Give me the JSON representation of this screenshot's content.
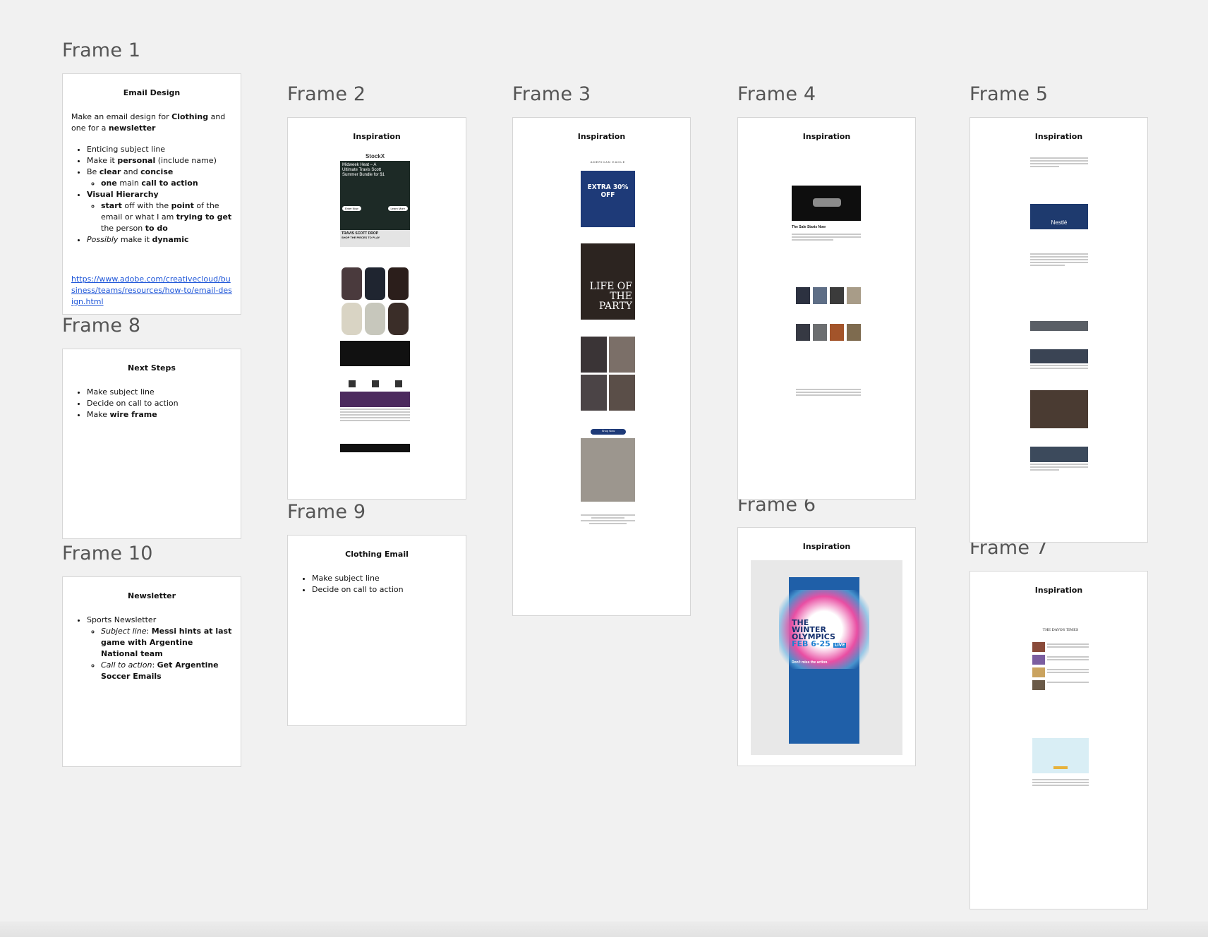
{
  "frames": {
    "f1": {
      "label": "Frame 1",
      "title": "Email Design",
      "intro_a": "Make an email design for ",
      "intro_b": "Clothing",
      "intro_c": " and one for a ",
      "intro_d": "newsletter",
      "b1": "Enticing subject line",
      "b2_a": "Make it ",
      "b2_b": "personal",
      "b2_c": " (include name)",
      "b3_a": "Be ",
      "b3_b": "clear",
      "b3_c": " and ",
      "b3_d": "concise",
      "b3s_a": "one",
      "b3s_b": " main ",
      "b3s_c": "call to action",
      "b4": "Visual Hierarchy",
      "b4s_a": "start",
      "b4s_b": " off with the ",
      "b4s_c": "point",
      "b4s_d": " of the email or what I am ",
      "b4s_e": "trying to get",
      "b4s_f": " the person ",
      "b4s_g": "to do",
      "b5_a": "Possibly",
      "b5_b": " make it ",
      "b5_c": "dynamic",
      "link": "https://www.adobe.com/creativecloud/business/teams/resources/how-to/email-design.html"
    },
    "f2": {
      "label": "Frame 2",
      "title": "Inspiration",
      "stockx": "StockX",
      "hero_line1": "Midweek Heat – A",
      "hero_line2": "Ultimate Travis Scott",
      "hero_line3": "Summer Bundle for $1",
      "btn1": "Enter Now",
      "btn2": "Learn More",
      "banner": "TRAVIS SCOTT DROP",
      "banner2": "SHOP THE PIECES TO PLAY"
    },
    "f3": {
      "label": "Frame 3",
      "title": "Inspiration",
      "brand": "AMERICAN EAGLE",
      "sale_a": "EXTRA 30",
      "sale_b": "% OFF",
      "party_a": "LIFE OF",
      "party_b": "THE PARTY",
      "shop": "Shop Now"
    },
    "f4": {
      "label": "Frame 4",
      "title": "Inspiration",
      "headline": "The Sale Starts Now"
    },
    "f5": {
      "label": "Frame 5",
      "title": "Inspiration",
      "brand": "Nestlé"
    },
    "f6": {
      "label": "Frame 6",
      "title": "Inspiration",
      "olympics_a": "THE",
      "olympics_b": "WINTER",
      "olympics_c": "OLYMPICS",
      "dates": "FEB 6-25",
      "live": "LIVE",
      "cta": "Don't miss the action."
    },
    "f7": {
      "label": "Frame 7",
      "title": "Inspiration",
      "paper": "THE DAVOS TIMES"
    },
    "f8": {
      "label": "Frame 8",
      "title": "Next Steps",
      "b1": "Make subject line",
      "b2": "Decide on call to action",
      "b3_a": "Make ",
      "b3_b": "wire frame"
    },
    "f9": {
      "label": "Frame 9",
      "title": "Clothing Email",
      "b1": "Make subject line",
      "b2": "Decide on call to action"
    },
    "f10": {
      "label": "Frame 10",
      "title": "Newsletter",
      "b1": "Sports Newsletter",
      "s1_a": "Subject line",
      "s1_b": ": ",
      "s1_c": "Messi hints at last game with Argentine National team",
      "s2_a": "Call to action",
      "s2_b": ": ",
      "s2_c": "Get Argentine Soccer Emails"
    }
  },
  "colors": {
    "canvas": "#f1f1f1",
    "link": "#1d55d8",
    "navy": "#1e3a78",
    "olympic_blue": "#1f5fa8",
    "pink": "#e94ea3"
  }
}
